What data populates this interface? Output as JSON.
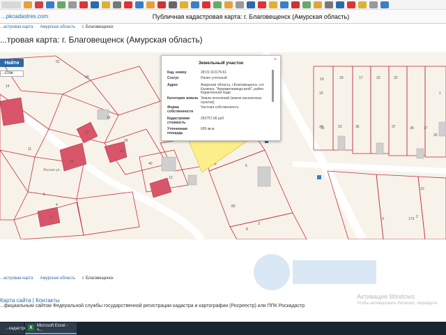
{
  "browser": {
    "site_name": "...pkcadastres.com",
    "window_title": "Публичная кадастровая карта: г. Благовещенск (Амурская область)"
  },
  "breadcrumb": {
    "items": [
      "...астровая карта",
      "Амурская область",
      "г. Благовещенск"
    ]
  },
  "page": {
    "title": "...тровая карта: г. Благовещенск (Амурская область)"
  },
  "search": {
    "button_label": "Найти",
    "select_value": "...сток"
  },
  "map": {
    "parcel_numbers": [
      "52",
      "39",
      "14",
      "16",
      "27",
      "41",
      "11",
      "23",
      "40",
      "13",
      "6",
      "5",
      "4",
      "3",
      "85",
      "2",
      "19",
      "18",
      "17",
      "33",
      "32",
      "34",
      "36",
      "37",
      "38",
      "8",
      "10",
      "2",
      "173",
      "9",
      "33",
      "22",
      "26",
      "26",
      "17",
      "19",
      "1"
    ],
    "street_label": "Лесная ул."
  },
  "popup": {
    "title": "Земельный участок",
    "close": "×",
    "rows": [
      {
        "label": "Кад. номер",
        "value": "28:01:110176:61"
      },
      {
        "label": "Статус",
        "value": "Ранее учтенный"
      },
      {
        "label": "Адрес",
        "value": "Амурская область, г.Благовещенск, снт Калинка, \"Амурмелиоводстрой\", район Карантинной пади"
      },
      {
        "label": "Категория земель",
        "value": "Земли поселений (земли населенных пунктов)"
      },
      {
        "label": "Форма собственности",
        "value": "Частная собственность"
      },
      {
        "label": "Кадастровая стоимость",
        "value": "262757,66 руб"
      },
      {
        "label": "Уточненная площадь",
        "value": "605 кв.м"
      }
    ]
  },
  "footer": {
    "links": "Карта сайта | Контакты",
    "description": "...фициальным сайтом Федеральной службы государственной регистрации кадастра и картографии (Росреестр) или ППК Роскадастр"
  },
  "activation": {
    "line1": "Активация Windows",
    "line2": "Чтобы активировать Windows, перейдите"
  },
  "taskbar": {
    "item1": "...кадастров...",
    "item2": "Microsoft Excel - ч..."
  },
  "colors": {
    "accent": "#2b6aa8",
    "building": "#d9556a",
    "selected_parcel": "#fcef8a"
  }
}
